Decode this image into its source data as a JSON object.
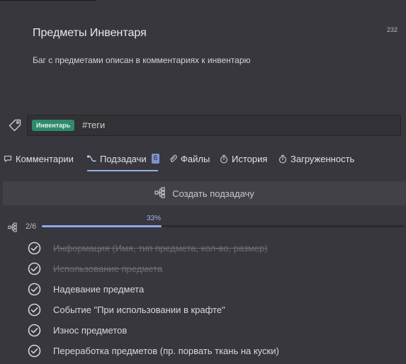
{
  "task": {
    "title": "Предметы Инвентаря",
    "number": "232",
    "description": "Баг с предметами описан в комментариях к инвентарю"
  },
  "tags": {
    "chip_label": "Инвентарь",
    "input_value": "#теги"
  },
  "tabs": [
    {
      "label": "Комментарии",
      "icon": "comment-icon"
    },
    {
      "label": "Подзадачи",
      "icon": "subtasks-icon",
      "badge": "6",
      "active": true
    },
    {
      "label": "Файлы",
      "icon": "paperclip-icon"
    },
    {
      "label": "История",
      "icon": "timer-icon"
    },
    {
      "label": "Загруженность",
      "icon": "timer-icon"
    }
  ],
  "create_subtask": {
    "label": "Создать подзадачу",
    "icon": "subtask-tree-icon"
  },
  "progress": {
    "count": "2/6",
    "percent_label": "33%",
    "fraction": 0.33
  },
  "subtasks": [
    {
      "label": "Информация (Имя, тип предмета, кол-во, размер)",
      "done": true
    },
    {
      "label": "Использование предмета",
      "done": true
    },
    {
      "label": "Надевание предмета",
      "done": false
    },
    {
      "label": "Событие \"При использовании в крафте\"",
      "done": false
    },
    {
      "label": "Износ предметов",
      "done": false
    },
    {
      "label": "Переработка предметов (пр. порвать ткань на куски)",
      "done": false
    }
  ],
  "colors": {
    "background": "#37373d",
    "accent": "#8fa7ea",
    "tag_chip": "#2f8a6c"
  }
}
